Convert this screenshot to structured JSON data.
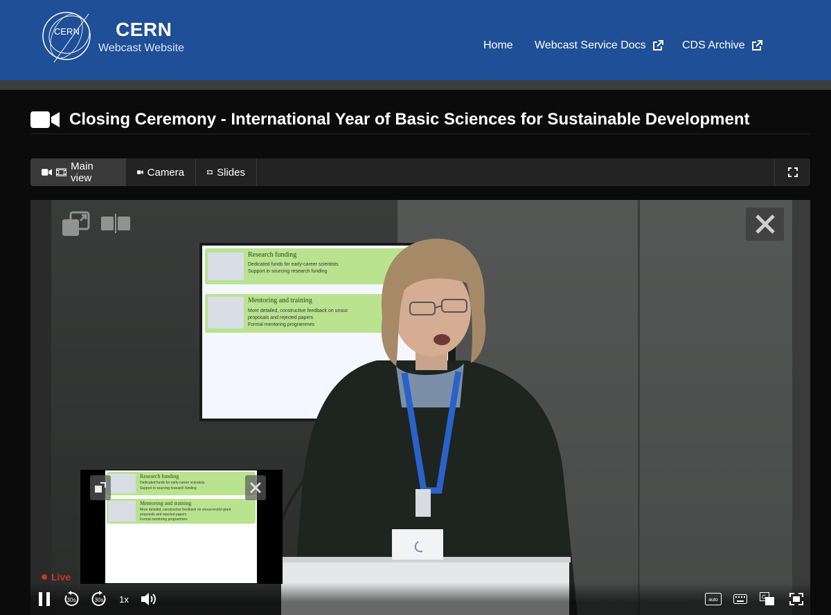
{
  "header": {
    "logo_text": "CERN",
    "brand_title": "CERN",
    "brand_subtitle": "Webcast Website",
    "nav": [
      {
        "label": "Home"
      },
      {
        "label": "Webcast Service Docs",
        "external": true
      },
      {
        "label": "CDS Archive",
        "external": true
      }
    ]
  },
  "event": {
    "title": "Closing Ceremony - International Year of Basic Sciences for Sustainable Development"
  },
  "tabs": [
    {
      "label": "Main view",
      "icons": [
        "camera-icon",
        "film-icon"
      ],
      "active": true
    },
    {
      "label": "Camera",
      "icons": [
        "camera-icon"
      ],
      "active": false
    },
    {
      "label": "Slides",
      "icons": [
        "film-icon"
      ],
      "active": false
    }
  ],
  "slide": {
    "section1_title": "Research funding",
    "section1_items": [
      "Dedicated funds for early-career scientists",
      "Support in sourcing research funding"
    ],
    "section2_title": "Mentoring and training",
    "section2_items_big": [
      "More detailed, constructive feedback on unsuc",
      "proposals and rejected papers",
      "Formal mentoring programmes"
    ],
    "section2_items_pip": [
      "More detailed, constructive feedback on unsuccessful grant",
      "proposals and rejected papers",
      "Formal mentoring programmes"
    ]
  },
  "player": {
    "live_label": "Live",
    "rewind_label": "30s",
    "forward_label": "30s",
    "speed_label": "1x",
    "quality_label": "auto",
    "state": "playing"
  },
  "colors": {
    "header_bg": "#1f4f96",
    "page_bg": "#0b0b0b",
    "live_red": "#c0392b",
    "slide_green": "#b9e38f"
  }
}
